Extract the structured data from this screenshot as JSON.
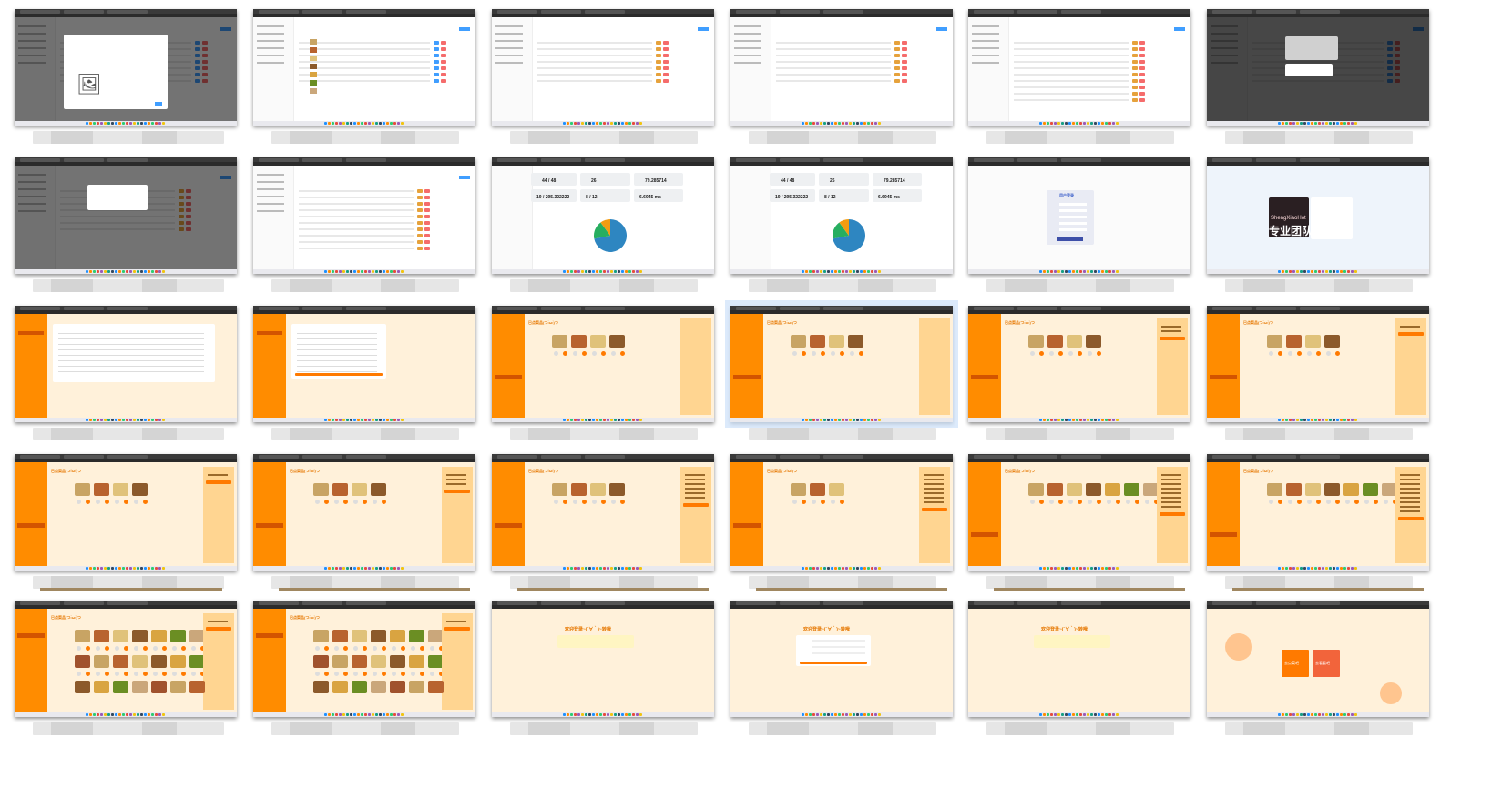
{
  "stats": {
    "row1": [
      "44 / 48",
      "26",
      "79.285714"
    ],
    "row2": [
      "19 / 295.322222",
      "8 / 12",
      "6.6945 ms"
    ]
  },
  "food_title": "已点菜品(つ•̀ω•́)つ",
  "welcome_title": "欢迎登录~(´∀｀)~转哦",
  "login_title": "用户登录",
  "poster_text": "专业团队",
  "poster_brand": "ShengXiaoHot",
  "checkout_label": "结算",
  "orange_buttons": [
    "去点菜吧",
    "去看看吧"
  ],
  "colors": {
    "orange": "#ff8c00",
    "cream": "#fff1da",
    "cart": "#ffd591",
    "danger": "#f56c6c",
    "primary": "#409eff",
    "pie_blue": "#2e86c1",
    "pie_green": "#27ae60",
    "pie_orange": "#f39c12"
  }
}
